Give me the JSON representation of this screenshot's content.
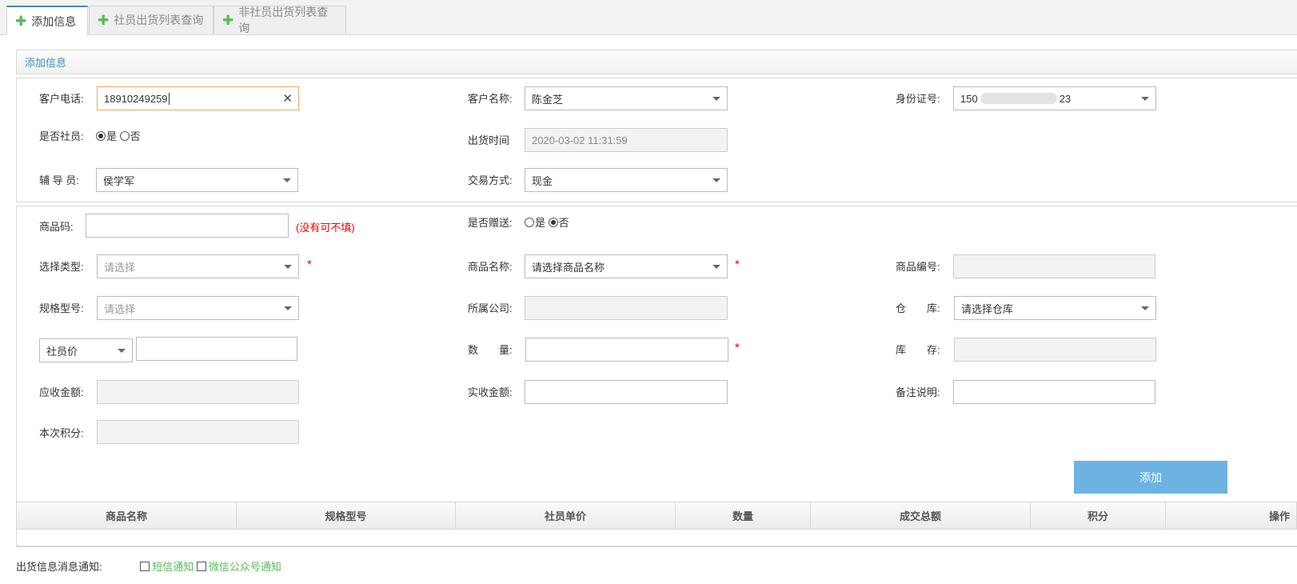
{
  "tabs": [
    {
      "label": "添加信息"
    },
    {
      "label": "社员出货列表查询"
    },
    {
      "label": "非社员出货列表查询"
    }
  ],
  "panel_title": "添加信息",
  "customer": {
    "phone_label": "客户电话:",
    "phone_value": "18910249259",
    "name_label": "客户名称:",
    "name_value": "陈金芝",
    "id_label": "身份证号:",
    "id_value_prefix": "150",
    "id_value_suffix": "23",
    "member_label": "是否社员:",
    "member_yes": "是",
    "member_no": "否",
    "member_selected": "是",
    "ship_time_label": "出货时间",
    "ship_time_value": "2020-03-02 11:31:59",
    "advisor_label": "辅 导 员:",
    "advisor_value": "侯学军",
    "pay_label": "交易方式:",
    "pay_value": "现金"
  },
  "product": {
    "code_label": "商品码:",
    "code_value": "",
    "code_hint": "(没有可不填)",
    "gift_label": "是否赠送:",
    "gift_yes": "是",
    "gift_no": "否",
    "gift_selected": "否",
    "type_label": "选择类型:",
    "type_placeholder": "请选择",
    "name_label": "商品名称:",
    "name_placeholder": "请选择商品名称",
    "number_label": "商品编号:",
    "spec_label": "规格型号:",
    "spec_placeholder": "请选择",
    "company_label": "所属公司:",
    "warehouse_label": "仓　　库:",
    "warehouse_placeholder": "请选择仓库",
    "price_type_value": "社员价",
    "qty_label": "数　　量:",
    "stock_label": "库　　存:",
    "receivable_label": "应收金额:",
    "received_label": "实收金额:",
    "remark_label": "备注说明:",
    "points_label": "本次积分:",
    "required_mark": "*"
  },
  "add_button": "添加",
  "table": {
    "columns": [
      "商品名称",
      "规格型号",
      "社员单价",
      "数量",
      "成交总额",
      "积分",
      "操作"
    ]
  },
  "notify": {
    "label": "出货信息消息通知:",
    "sms": "短信通知",
    "wechat": "微信公众号通知"
  },
  "colors": {
    "accent": "#3c8dbc",
    "button": "#6db3e2",
    "required": "#e00000",
    "plus": "#5cb85c"
  }
}
